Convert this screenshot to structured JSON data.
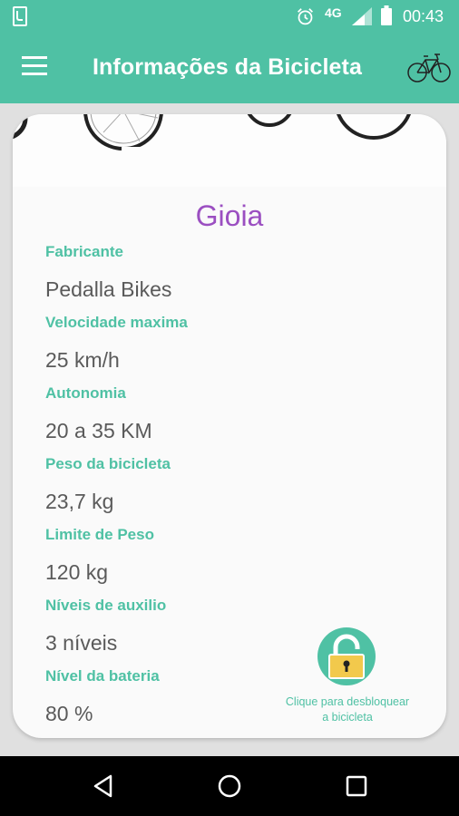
{
  "status_bar": {
    "network": "4G",
    "time": "00:43",
    "icons": [
      "sim-card-icon",
      "alarm-icon",
      "cell-signal-icon",
      "battery-icon"
    ]
  },
  "toolbar": {
    "title": "Informações da Bicicleta",
    "menu_icon": "hamburger-menu-icon",
    "action_icon": "bicycle-icon"
  },
  "bike": {
    "name": "Gioia",
    "fields": [
      {
        "label": "Fabricante",
        "value": "Pedalla Bikes"
      },
      {
        "label": "Velocidade maxima",
        "value": "25 km/h"
      },
      {
        "label": "Autonomia",
        "value": "20 a 35 KM"
      },
      {
        "label": "Peso da bicicleta",
        "value": "23,7 kg"
      },
      {
        "label": "Limite de Peso",
        "value": "120 kg"
      },
      {
        "label": "Níveis de auxilio",
        "value": "3 níveis"
      },
      {
        "label": "Nível da bateria",
        "value": "80 %"
      }
    ]
  },
  "unlock": {
    "icon": "open-padlock-icon",
    "caption_line1": "Clique para desbloquear",
    "caption_line2": "a bicicleta"
  },
  "nav_bar": {
    "icons": [
      "back-triangle-icon",
      "home-circle-icon",
      "recents-square-icon"
    ]
  },
  "colors": {
    "primary": "#4fc1a4",
    "name_purple": "#9b4fc1",
    "value_gray": "#5a5a5a",
    "lock_yellow": "#f2c94c"
  }
}
